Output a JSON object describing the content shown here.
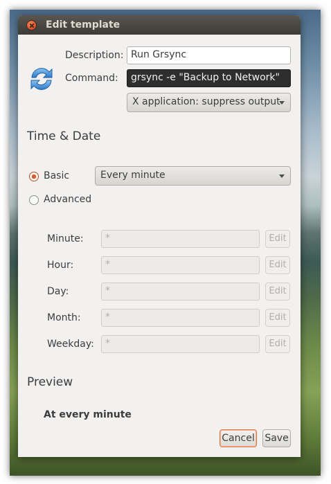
{
  "window": {
    "title": "Edit template"
  },
  "form": {
    "description_label": "Description:",
    "description_value": "Run Grsync",
    "command_label": "Command:",
    "command_value": "grsync -e \"Backup to Network\"",
    "output_option": "X application: suppress output"
  },
  "time_date": {
    "heading": "Time & Date",
    "basic_label": "Basic",
    "advanced_label": "Advanced",
    "selected_mode": "Basic",
    "frequency": "Every minute",
    "fields": [
      {
        "label": "Minute:",
        "value": "*",
        "edit_label": "Edit"
      },
      {
        "label": "Hour:",
        "value": "*",
        "edit_label": "Edit"
      },
      {
        "label": "Day:",
        "value": "*",
        "edit_label": "Edit"
      },
      {
        "label": "Month:",
        "value": "*",
        "edit_label": "Edit"
      },
      {
        "label": "Weekday:",
        "value": "*",
        "edit_label": "Edit"
      }
    ]
  },
  "preview": {
    "heading": "Preview",
    "text": "At every minute"
  },
  "buttons": {
    "cancel": "Cancel",
    "save": "Save"
  },
  "icons": {
    "close": "close-icon",
    "refresh": "refresh-icon"
  },
  "colors": {
    "accent": "#e0582a",
    "titlebar": "#3c3b37",
    "window_bg": "#f2f1f0"
  }
}
